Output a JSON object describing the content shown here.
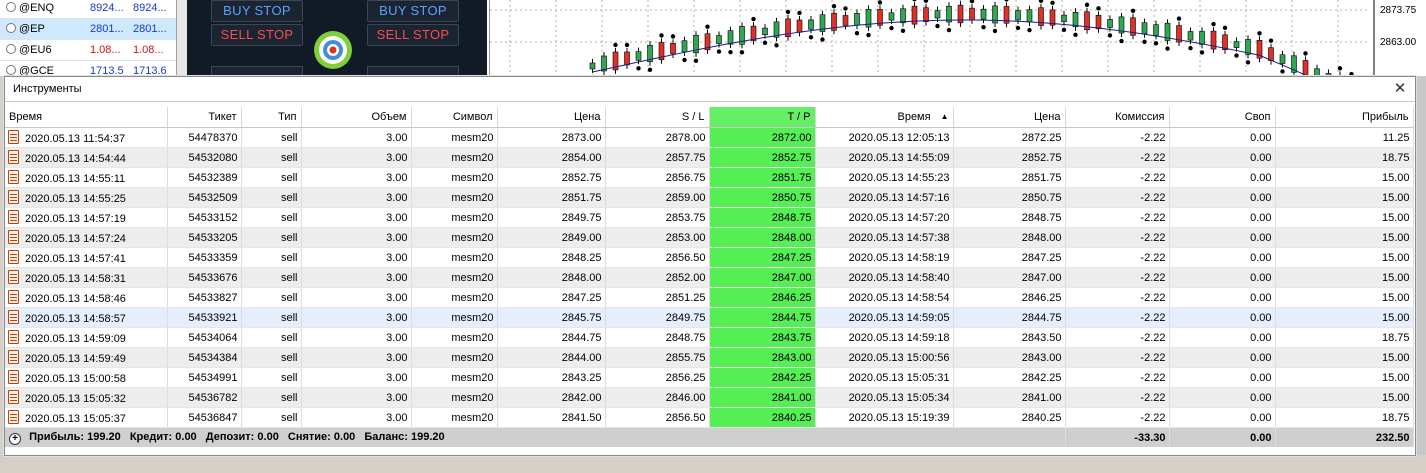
{
  "watchlist": [
    {
      "symbol": "@ENQ",
      "bid": "8924...",
      "ask": "8924...",
      "color": "blue"
    },
    {
      "symbol": "@EP",
      "bid": "2801...",
      "ask": "2801...",
      "color": "blue"
    },
    {
      "symbol": "@EU6",
      "bid": "1.08...",
      "ask": "1.08...",
      "color": "red"
    },
    {
      "symbol": "@GCE",
      "bid": "1713.5",
      "ask": "1713.6",
      "color": "blue"
    }
  ],
  "trade_panel": {
    "buy_stop_left": "BUY STOP",
    "buy_stop_right": "BUY STOP",
    "sell_stop_left": "SELL STOP",
    "sell_stop_right": "SELL STOP"
  },
  "chart": {
    "price_labels": [
      "2873.75",
      "2863.00"
    ]
  },
  "terminal": {
    "title": "Инструменты",
    "close_symbol": "✕",
    "columns": {
      "open_time": "Время",
      "ticket": "Тикет",
      "type": "Тип",
      "volume": "Объем",
      "symbol": "Символ",
      "price": "Цена",
      "sl": "S / L",
      "tp": "T / P",
      "close_time": "Время",
      "close_price": "Цена",
      "commission": "Комиссия",
      "swap": "Своп",
      "profit": "Прибыль"
    },
    "sort_arrow": "▲",
    "rows": [
      [
        "2020.05.13 11:54:37",
        "54478370",
        "sell",
        "3.00",
        "mesm20",
        "2873.00",
        "2878.00",
        "2872.00",
        "2020.05.13 12:05:13",
        "2872.25",
        "-2.22",
        "0.00",
        "11.25"
      ],
      [
        "2020.05.13 14:54:44",
        "54532080",
        "sell",
        "3.00",
        "mesm20",
        "2854.00",
        "2857.75",
        "2852.75",
        "2020.05.13 14:55:09",
        "2852.75",
        "-2.22",
        "0.00",
        "18.75"
      ],
      [
        "2020.05.13 14:55:11",
        "54532389",
        "sell",
        "3.00",
        "mesm20",
        "2852.75",
        "2856.75",
        "2851.75",
        "2020.05.13 14:55:23",
        "2851.75",
        "-2.22",
        "0.00",
        "15.00"
      ],
      [
        "2020.05.13 14:55:25",
        "54532509",
        "sell",
        "3.00",
        "mesm20",
        "2851.75",
        "2859.00",
        "2850.75",
        "2020.05.13 14:57:16",
        "2850.75",
        "-2.22",
        "0.00",
        "15.00"
      ],
      [
        "2020.05.13 14:57:19",
        "54533152",
        "sell",
        "3.00",
        "mesm20",
        "2849.75",
        "2853.75",
        "2848.75",
        "2020.05.13 14:57:20",
        "2848.75",
        "-2.22",
        "0.00",
        "15.00"
      ],
      [
        "2020.05.13 14:57:24",
        "54533205",
        "sell",
        "3.00",
        "mesm20",
        "2849.00",
        "2853.00",
        "2848.00",
        "2020.05.13 14:57:38",
        "2848.00",
        "-2.22",
        "0.00",
        "15.00"
      ],
      [
        "2020.05.13 14:57:41",
        "54533359",
        "sell",
        "3.00",
        "mesm20",
        "2848.25",
        "2856.50",
        "2847.25",
        "2020.05.13 14:58:19",
        "2847.25",
        "-2.22",
        "0.00",
        "15.00"
      ],
      [
        "2020.05.13 14:58:31",
        "54533676",
        "sell",
        "3.00",
        "mesm20",
        "2848.00",
        "2852.00",
        "2847.00",
        "2020.05.13 14:58:40",
        "2847.00",
        "-2.22",
        "0.00",
        "15.00"
      ],
      [
        "2020.05.13 14:58:46",
        "54533827",
        "sell",
        "3.00",
        "mesm20",
        "2847.25",
        "2851.25",
        "2846.25",
        "2020.05.13 14:58:54",
        "2846.25",
        "-2.22",
        "0.00",
        "15.00"
      ],
      [
        "2020.05.13 14:58:57",
        "54533921",
        "sell",
        "3.00",
        "mesm20",
        "2845.75",
        "2849.75",
        "2844.75",
        "2020.05.13 14:59:05",
        "2844.75",
        "-2.22",
        "0.00",
        "15.00"
      ],
      [
        "2020.05.13 14:59:09",
        "54534064",
        "sell",
        "3.00",
        "mesm20",
        "2844.75",
        "2848.75",
        "2843.75",
        "2020.05.13 14:59:18",
        "2843.50",
        "-2.22",
        "0.00",
        "18.75"
      ],
      [
        "2020.05.13 14:59:49",
        "54534384",
        "sell",
        "3.00",
        "mesm20",
        "2844.00",
        "2855.75",
        "2843.00",
        "2020.05.13 15:00:56",
        "2843.00",
        "-2.22",
        "0.00",
        "15.00"
      ],
      [
        "2020.05.13 15:00:58",
        "54534991",
        "sell",
        "3.00",
        "mesm20",
        "2843.25",
        "2856.25",
        "2842.25",
        "2020.05.13 15:05:31",
        "2842.25",
        "-2.22",
        "0.00",
        "15.00"
      ],
      [
        "2020.05.13 15:05:32",
        "54536782",
        "sell",
        "3.00",
        "mesm20",
        "2842.00",
        "2846.00",
        "2841.00",
        "2020.05.13 15:05:34",
        "2841.00",
        "-2.22",
        "0.00",
        "15.00"
      ],
      [
        "2020.05.13 15:05:37",
        "54536847",
        "sell",
        "3.00",
        "mesm20",
        "2841.50",
        "2856.50",
        "2840.25",
        "2020.05.13 15:19:39",
        "2840.25",
        "-2.22",
        "0.00",
        "18.75"
      ]
    ],
    "highlighted_row": 9,
    "summary": {
      "profit_label": "Прибыль:",
      "profit_value": "199.20",
      "credit_label": "Кредит:",
      "credit_value": "0.00",
      "deposit_label": "Депозит:",
      "deposit_value": "0.00",
      "withdrawal_label": "Снятие:",
      "withdrawal_value": "0.00",
      "balance_label": "Баланс:",
      "balance_value": "199.20",
      "total_commission": "-33.30",
      "total_swap": "0.00",
      "total_profit": "232.50"
    }
  },
  "colors": {
    "tp_column": "#55ee55",
    "buy": "#5aa3ff",
    "sell": "#ff4b4b"
  }
}
